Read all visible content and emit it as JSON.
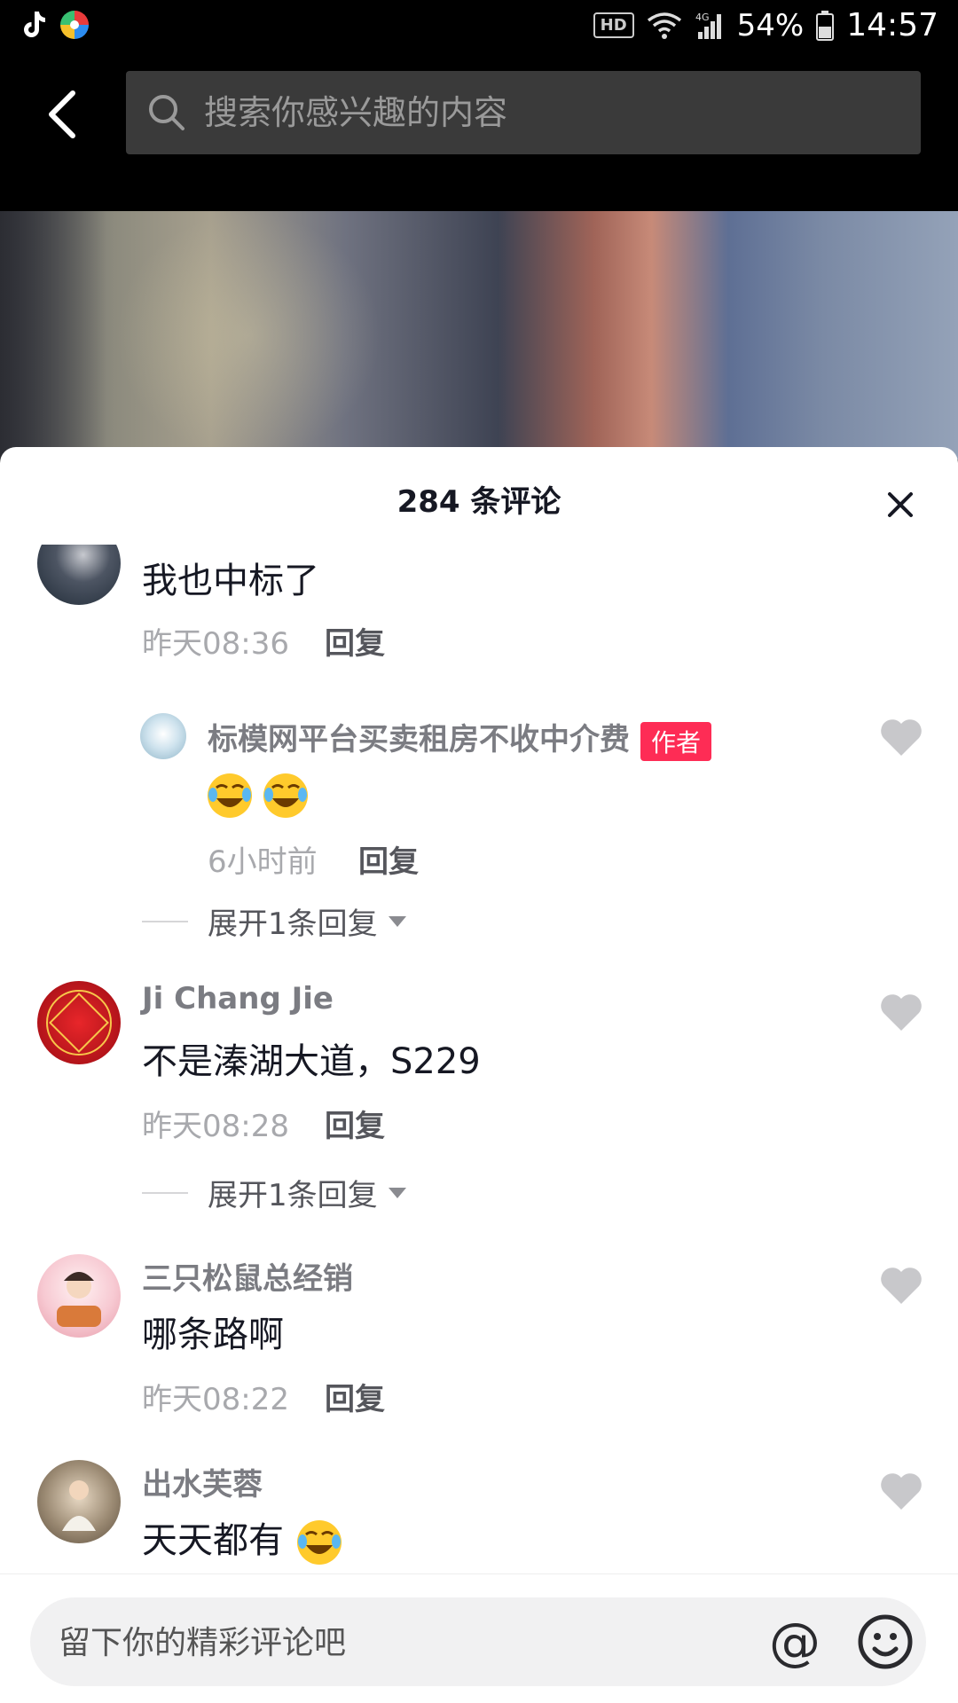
{
  "status_bar": {
    "hd": "HD",
    "network": "4G",
    "battery": "54%",
    "time": "14:57"
  },
  "search": {
    "placeholder": "搜索你感兴趣的内容"
  },
  "sheet": {
    "title": "284 条评论"
  },
  "comments": [
    {
      "name": "",
      "text": "我也中标了",
      "time": "昨天08:36",
      "reply_label": "回复"
    },
    {
      "name": "标模网平台买卖租房不收中介费",
      "badge": "作者",
      "emojis": [
        "laugh-cry-emoji",
        "laugh-cry-emoji"
      ],
      "time": "6小时前",
      "reply_label": "回复",
      "is_reply": true
    },
    {
      "name": "Ji Chang Jie",
      "text": "不是溱湖大道，S229",
      "time": "昨天08:28",
      "reply_label": "回复"
    },
    {
      "name": "三只松鼠总经销",
      "text": "哪条路啊",
      "time": "昨天08:22",
      "reply_label": "回复"
    },
    {
      "name": "出水芙蓉",
      "text": "天天都有",
      "emoji": "laugh-cry-emoji"
    }
  ],
  "expand_replies": [
    {
      "label": "展开1条回复"
    },
    {
      "label": "展开1条回复"
    }
  ],
  "input_bar": {
    "placeholder": "留下你的精彩评论吧",
    "at_symbol": "@"
  },
  "colors": {
    "accent": "#fe2c55",
    "text_primary": "#161823",
    "text_secondary": "#7b7c82"
  }
}
